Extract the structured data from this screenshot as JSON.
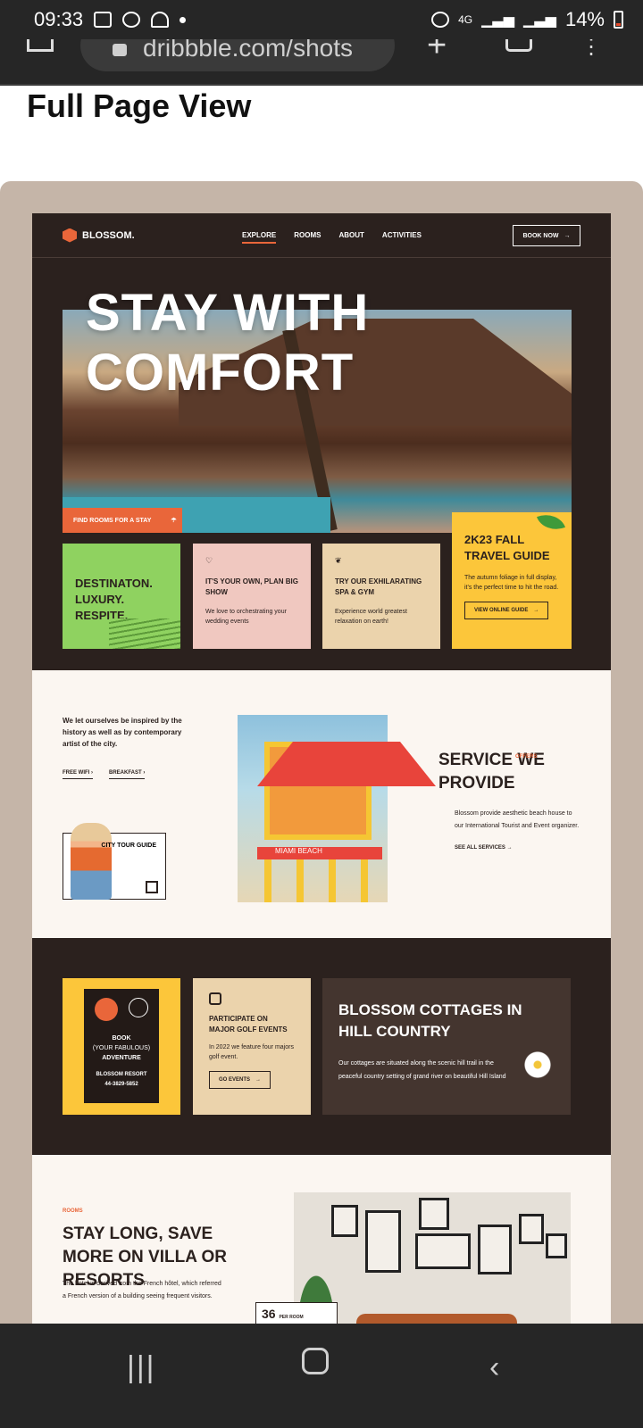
{
  "status": {
    "time": "09:33",
    "network": "4G",
    "battery": "14%"
  },
  "browser": {
    "url": "dribbble.com/shots"
  },
  "page": {
    "heading": "Full Page View"
  },
  "site": {
    "logo": "BLOSSOM.",
    "nav": [
      "EXPLORE",
      "ROOMS",
      "ABOUT",
      "ACTIVITIES"
    ],
    "book_now": "BOOK NOW",
    "hero_title": "STAY WITH COMFORT",
    "find_rooms": "FIND ROOMS FOR A STAY",
    "cards": {
      "green": "DESTINATON. LUXURY. RESPITE.",
      "pink_title": "IT'S YOUR OWN, PLAN BIG SHOW",
      "pink_sub": "We love to orchestrating your wedding events",
      "sand_title": "TRY OUR EXHILARATING SPA & GYM",
      "sand_sub": "Experience world greatest relaxation on earth!",
      "yellow_title": "2K23 FALL TRAVEL GUIDE",
      "yellow_sub": "The autumn foliage in full display, it's the perfect time to hit the road.",
      "yellow_btn": "VIEW ONLINE GUIDE"
    },
    "intro": "We let ourselves be inspired by the history as well as by contemporary artist of the city.",
    "links": [
      "FREE WIFI",
      "BREAKFAST"
    ],
    "city_tour": "CITY TOUR GUIDE",
    "tower_band": "MIAMI BEACH",
    "service_title": "SERVICE WE PROVIDE",
    "service_offers": "OFFERS",
    "service_text": "Blossom provide aesthetic beach house to our International Tourist and Event organizer.",
    "service_link": "SEE ALL SERVICES",
    "sign": {
      "line1": "BOOK",
      "line2": "(YOUR FABULOUS)",
      "line3": "ADVENTURE",
      "line4": "BLOSSOM RESORT",
      "line5": "44-3829-5852"
    },
    "golf_title": "PARTICIPATE ON MAJOR GOLF EVENTS",
    "golf_sub": "In 2022 we feature four majors golf event.",
    "golf_btn": "GO EVENTS",
    "cottages_title": "BLOSSOM COTTAGES IN HILL COUNTRY",
    "cottages_sub": "Our cottages are situated along the scenic hill trail in the peaceful country setting of grand river on beautiful Hill Island",
    "rooms_label": "ROOMS",
    "stay_title": "STAY LONG, SAVE MORE ON VILLA OR RESORTS",
    "stay_sub": "The hotel is derived from the French hôtel, which referred a French version of a building seeing frequent visitors.",
    "price": "36",
    "price_unit": "PER ROOM"
  }
}
